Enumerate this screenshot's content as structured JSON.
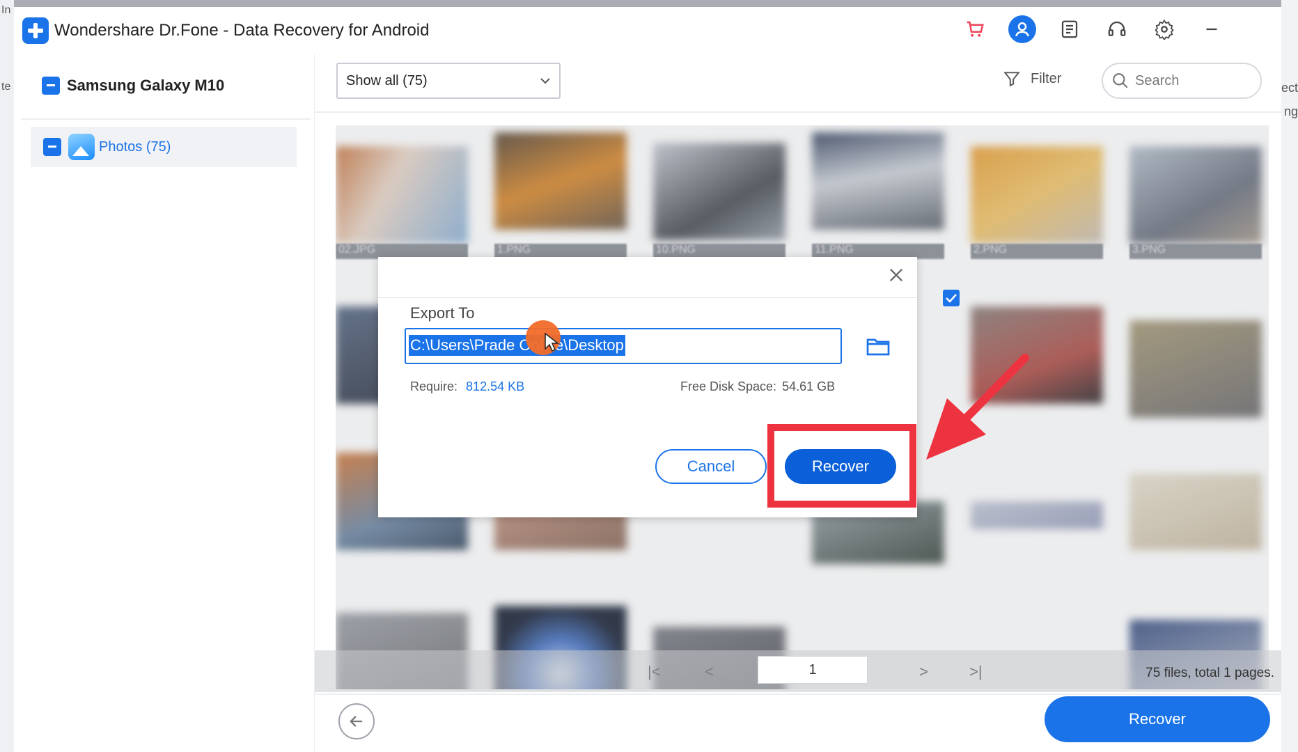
{
  "window": {
    "title": "Wondershare Dr.Fone - Data Recovery for Android"
  },
  "edges": {
    "left_top": "In",
    "left_mid": "te",
    "right_mid1": "ect",
    "right_mid2": "ng"
  },
  "title_icons": [
    "cart-icon",
    "user-avatar-icon",
    "feedback-icon",
    "support-headset-icon",
    "gear-icon",
    "minimize-icon"
  ],
  "sidebar": {
    "device": "Samsung Galaxy M10",
    "items": [
      {
        "label": "Photos (75)",
        "icon": "photos-icon"
      }
    ]
  },
  "toolbar": {
    "dropdown_value": "Show all (75)",
    "filter_label": "Filter",
    "search_placeholder": "Search"
  },
  "grid": {
    "captions": [
      "02.JPG",
      "1.PNG",
      "10.PNG",
      "11.PNG",
      "2.PNG",
      "3.PNG"
    ]
  },
  "pagination": {
    "current_page": "1",
    "info": "75 files, total 1 pages."
  },
  "bottom": {
    "recover_label": "Recover"
  },
  "dialog": {
    "export_label": "Export To",
    "path_value": "C:\\Users\\Prade   Online\\Desktop",
    "require_label": "Require:",
    "require_value": "812.54 KB",
    "free_label": "Free Disk Space:",
    "free_value": "54.61 GB",
    "cancel_label": "Cancel",
    "recover_label": "Recover"
  },
  "colors": {
    "accent": "#1a73e8",
    "highlight": "#ee3340",
    "cursor": "#f26b2a"
  }
}
